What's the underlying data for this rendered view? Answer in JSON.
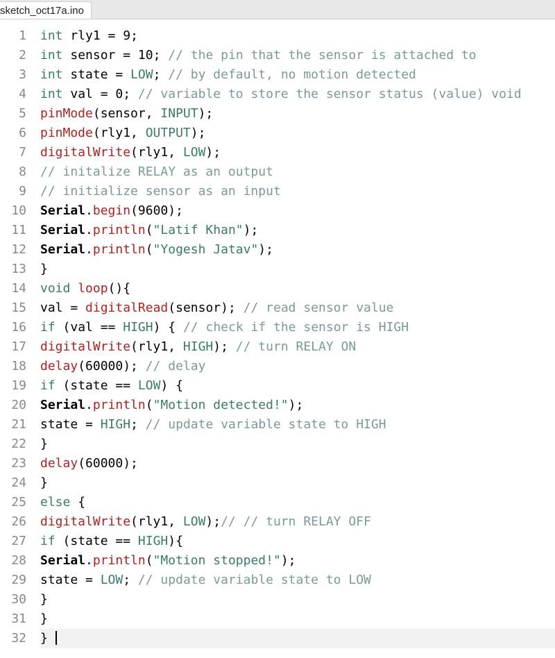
{
  "tab": {
    "title": "sketch_oct17a.ino"
  },
  "cursor_line": 32,
  "lines": [
    {
      "n": 1,
      "tokens": [
        {
          "c": "kw",
          "t": "int"
        },
        {
          "c": "plain",
          "t": " rly1 "
        },
        {
          "c": "plain",
          "t": "="
        },
        {
          "c": "plain",
          "t": " "
        },
        {
          "c": "num",
          "t": "9"
        },
        {
          "c": "plain",
          "t": ";"
        }
      ]
    },
    {
      "n": 2,
      "tokens": [
        {
          "c": "kw",
          "t": "int"
        },
        {
          "c": "plain",
          "t": " sensor "
        },
        {
          "c": "plain",
          "t": "="
        },
        {
          "c": "plain",
          "t": " "
        },
        {
          "c": "num",
          "t": "10"
        },
        {
          "c": "plain",
          "t": "; "
        },
        {
          "c": "cmt",
          "t": "// the pin that the sensor is attached to"
        }
      ]
    },
    {
      "n": 3,
      "tokens": [
        {
          "c": "kw",
          "t": "int"
        },
        {
          "c": "plain",
          "t": " state "
        },
        {
          "c": "plain",
          "t": "="
        },
        {
          "c": "plain",
          "t": " "
        },
        {
          "c": "const",
          "t": "LOW"
        },
        {
          "c": "plain",
          "t": "; "
        },
        {
          "c": "cmt",
          "t": "// by default, no motion detected"
        }
      ]
    },
    {
      "n": 4,
      "tokens": [
        {
          "c": "kw",
          "t": "int"
        },
        {
          "c": "plain",
          "t": " val "
        },
        {
          "c": "plain",
          "t": "="
        },
        {
          "c": "plain",
          "t": " "
        },
        {
          "c": "num",
          "t": "0"
        },
        {
          "c": "plain",
          "t": "; "
        },
        {
          "c": "cmt",
          "t": "// variable to store the sensor status (value) void"
        }
      ]
    },
    {
      "n": 5,
      "tokens": [
        {
          "c": "fn",
          "t": "pinMode"
        },
        {
          "c": "plain",
          "t": "(sensor, "
        },
        {
          "c": "const",
          "t": "INPUT"
        },
        {
          "c": "plain",
          "t": ");"
        }
      ]
    },
    {
      "n": 6,
      "tokens": [
        {
          "c": "fn",
          "t": "pinMode"
        },
        {
          "c": "plain",
          "t": "(rly1, "
        },
        {
          "c": "const",
          "t": "OUTPUT"
        },
        {
          "c": "plain",
          "t": ");"
        }
      ]
    },
    {
      "n": 7,
      "tokens": [
        {
          "c": "fn",
          "t": "digitalWrite"
        },
        {
          "c": "plain",
          "t": "(rly1, "
        },
        {
          "c": "const",
          "t": "LOW"
        },
        {
          "c": "plain",
          "t": ");"
        }
      ]
    },
    {
      "n": 8,
      "tokens": [
        {
          "c": "cmt",
          "t": "// initalize RELAY as an output"
        }
      ]
    },
    {
      "n": 9,
      "tokens": [
        {
          "c": "cmt",
          "t": "// initialize sensor as an input"
        }
      ]
    },
    {
      "n": 10,
      "tokens": [
        {
          "c": "obj",
          "t": "Serial"
        },
        {
          "c": "plain",
          "t": "."
        },
        {
          "c": "fn",
          "t": "begin"
        },
        {
          "c": "plain",
          "t": "("
        },
        {
          "c": "num",
          "t": "9600"
        },
        {
          "c": "plain",
          "t": ");"
        }
      ]
    },
    {
      "n": 11,
      "tokens": [
        {
          "c": "obj",
          "t": "Serial"
        },
        {
          "c": "plain",
          "t": "."
        },
        {
          "c": "fn",
          "t": "println"
        },
        {
          "c": "plain",
          "t": "("
        },
        {
          "c": "str",
          "t": "\"Latif Khan\""
        },
        {
          "c": "plain",
          "t": ");"
        }
      ]
    },
    {
      "n": 12,
      "tokens": [
        {
          "c": "obj",
          "t": "Serial"
        },
        {
          "c": "plain",
          "t": "."
        },
        {
          "c": "fn",
          "t": "println"
        },
        {
          "c": "plain",
          "t": "("
        },
        {
          "c": "str",
          "t": "\"Yogesh Jatav\""
        },
        {
          "c": "plain",
          "t": ");"
        }
      ]
    },
    {
      "n": 13,
      "tokens": [
        {
          "c": "plain",
          "t": "}"
        }
      ]
    },
    {
      "n": 14,
      "tokens": [
        {
          "c": "kw",
          "t": "void"
        },
        {
          "c": "plain",
          "t": " "
        },
        {
          "c": "fn",
          "t": "loop"
        },
        {
          "c": "plain",
          "t": "(){"
        }
      ]
    },
    {
      "n": 15,
      "tokens": [
        {
          "c": "plain",
          "t": "val "
        },
        {
          "c": "plain",
          "t": "="
        },
        {
          "c": "plain",
          "t": " "
        },
        {
          "c": "fn",
          "t": "digitalRead"
        },
        {
          "c": "plain",
          "t": "(sensor); "
        },
        {
          "c": "cmt",
          "t": "// read sensor value"
        }
      ]
    },
    {
      "n": 16,
      "tokens": [
        {
          "c": "kw",
          "t": "if"
        },
        {
          "c": "plain",
          "t": " (val "
        },
        {
          "c": "plain",
          "t": "=="
        },
        {
          "c": "plain",
          "t": " "
        },
        {
          "c": "const",
          "t": "HIGH"
        },
        {
          "c": "plain",
          "t": ") { "
        },
        {
          "c": "cmt",
          "t": "// check if the sensor is HIGH"
        }
      ]
    },
    {
      "n": 17,
      "tokens": [
        {
          "c": "fn",
          "t": "digitalWrite"
        },
        {
          "c": "plain",
          "t": "(rly1, "
        },
        {
          "c": "const",
          "t": "HIGH"
        },
        {
          "c": "plain",
          "t": "); "
        },
        {
          "c": "cmt",
          "t": "// turn RELAY ON"
        }
      ]
    },
    {
      "n": 18,
      "tokens": [
        {
          "c": "fn",
          "t": "delay"
        },
        {
          "c": "plain",
          "t": "("
        },
        {
          "c": "num",
          "t": "60000"
        },
        {
          "c": "plain",
          "t": "); "
        },
        {
          "c": "cmt",
          "t": "// delay"
        }
      ]
    },
    {
      "n": 19,
      "tokens": [
        {
          "c": "kw",
          "t": "if"
        },
        {
          "c": "plain",
          "t": " (state "
        },
        {
          "c": "plain",
          "t": "=="
        },
        {
          "c": "plain",
          "t": " "
        },
        {
          "c": "const",
          "t": "LOW"
        },
        {
          "c": "plain",
          "t": ") {"
        }
      ]
    },
    {
      "n": 20,
      "tokens": [
        {
          "c": "obj",
          "t": "Serial"
        },
        {
          "c": "plain",
          "t": "."
        },
        {
          "c": "fn",
          "t": "println"
        },
        {
          "c": "plain",
          "t": "("
        },
        {
          "c": "str",
          "t": "\"Motion detected!\""
        },
        {
          "c": "plain",
          "t": ");"
        }
      ]
    },
    {
      "n": 21,
      "tokens": [
        {
          "c": "plain",
          "t": "state "
        },
        {
          "c": "plain",
          "t": "="
        },
        {
          "c": "plain",
          "t": " "
        },
        {
          "c": "const",
          "t": "HIGH"
        },
        {
          "c": "plain",
          "t": "; "
        },
        {
          "c": "cmt",
          "t": "// update variable state to HIGH"
        }
      ]
    },
    {
      "n": 22,
      "tokens": [
        {
          "c": "plain",
          "t": "}"
        }
      ]
    },
    {
      "n": 23,
      "tokens": [
        {
          "c": "fn",
          "t": "delay"
        },
        {
          "c": "plain",
          "t": "("
        },
        {
          "c": "num",
          "t": "60000"
        },
        {
          "c": "plain",
          "t": ");"
        }
      ]
    },
    {
      "n": 24,
      "tokens": [
        {
          "c": "plain",
          "t": "}"
        }
      ]
    },
    {
      "n": 25,
      "tokens": [
        {
          "c": "kw",
          "t": "else"
        },
        {
          "c": "plain",
          "t": " {"
        }
      ]
    },
    {
      "n": 26,
      "tokens": [
        {
          "c": "fn",
          "t": "digitalWrite"
        },
        {
          "c": "plain",
          "t": "(rly1, "
        },
        {
          "c": "const",
          "t": "LOW"
        },
        {
          "c": "plain",
          "t": ");"
        },
        {
          "c": "cmt",
          "t": "// // turn RELAY OFF"
        }
      ]
    },
    {
      "n": 27,
      "tokens": [
        {
          "c": "kw",
          "t": "if"
        },
        {
          "c": "plain",
          "t": " (state "
        },
        {
          "c": "plain",
          "t": "=="
        },
        {
          "c": "plain",
          "t": " "
        },
        {
          "c": "const",
          "t": "HIGH"
        },
        {
          "c": "plain",
          "t": "){"
        }
      ]
    },
    {
      "n": 28,
      "tokens": [
        {
          "c": "obj",
          "t": "Serial"
        },
        {
          "c": "plain",
          "t": "."
        },
        {
          "c": "fn",
          "t": "println"
        },
        {
          "c": "plain",
          "t": "("
        },
        {
          "c": "str",
          "t": "\"Motion stopped!\""
        },
        {
          "c": "plain",
          "t": ");"
        }
      ]
    },
    {
      "n": 29,
      "tokens": [
        {
          "c": "plain",
          "t": "state "
        },
        {
          "c": "plain",
          "t": "="
        },
        {
          "c": "plain",
          "t": " "
        },
        {
          "c": "const",
          "t": "LOW"
        },
        {
          "c": "plain",
          "t": "; "
        },
        {
          "c": "cmt",
          "t": "// update variable state to LOW"
        }
      ]
    },
    {
      "n": 30,
      "tokens": [
        {
          "c": "plain",
          "t": "}"
        }
      ]
    },
    {
      "n": 31,
      "tokens": [
        {
          "c": "plain",
          "t": "}"
        }
      ]
    },
    {
      "n": 32,
      "tokens": [
        {
          "c": "plain",
          "t": "} "
        }
      ]
    }
  ]
}
